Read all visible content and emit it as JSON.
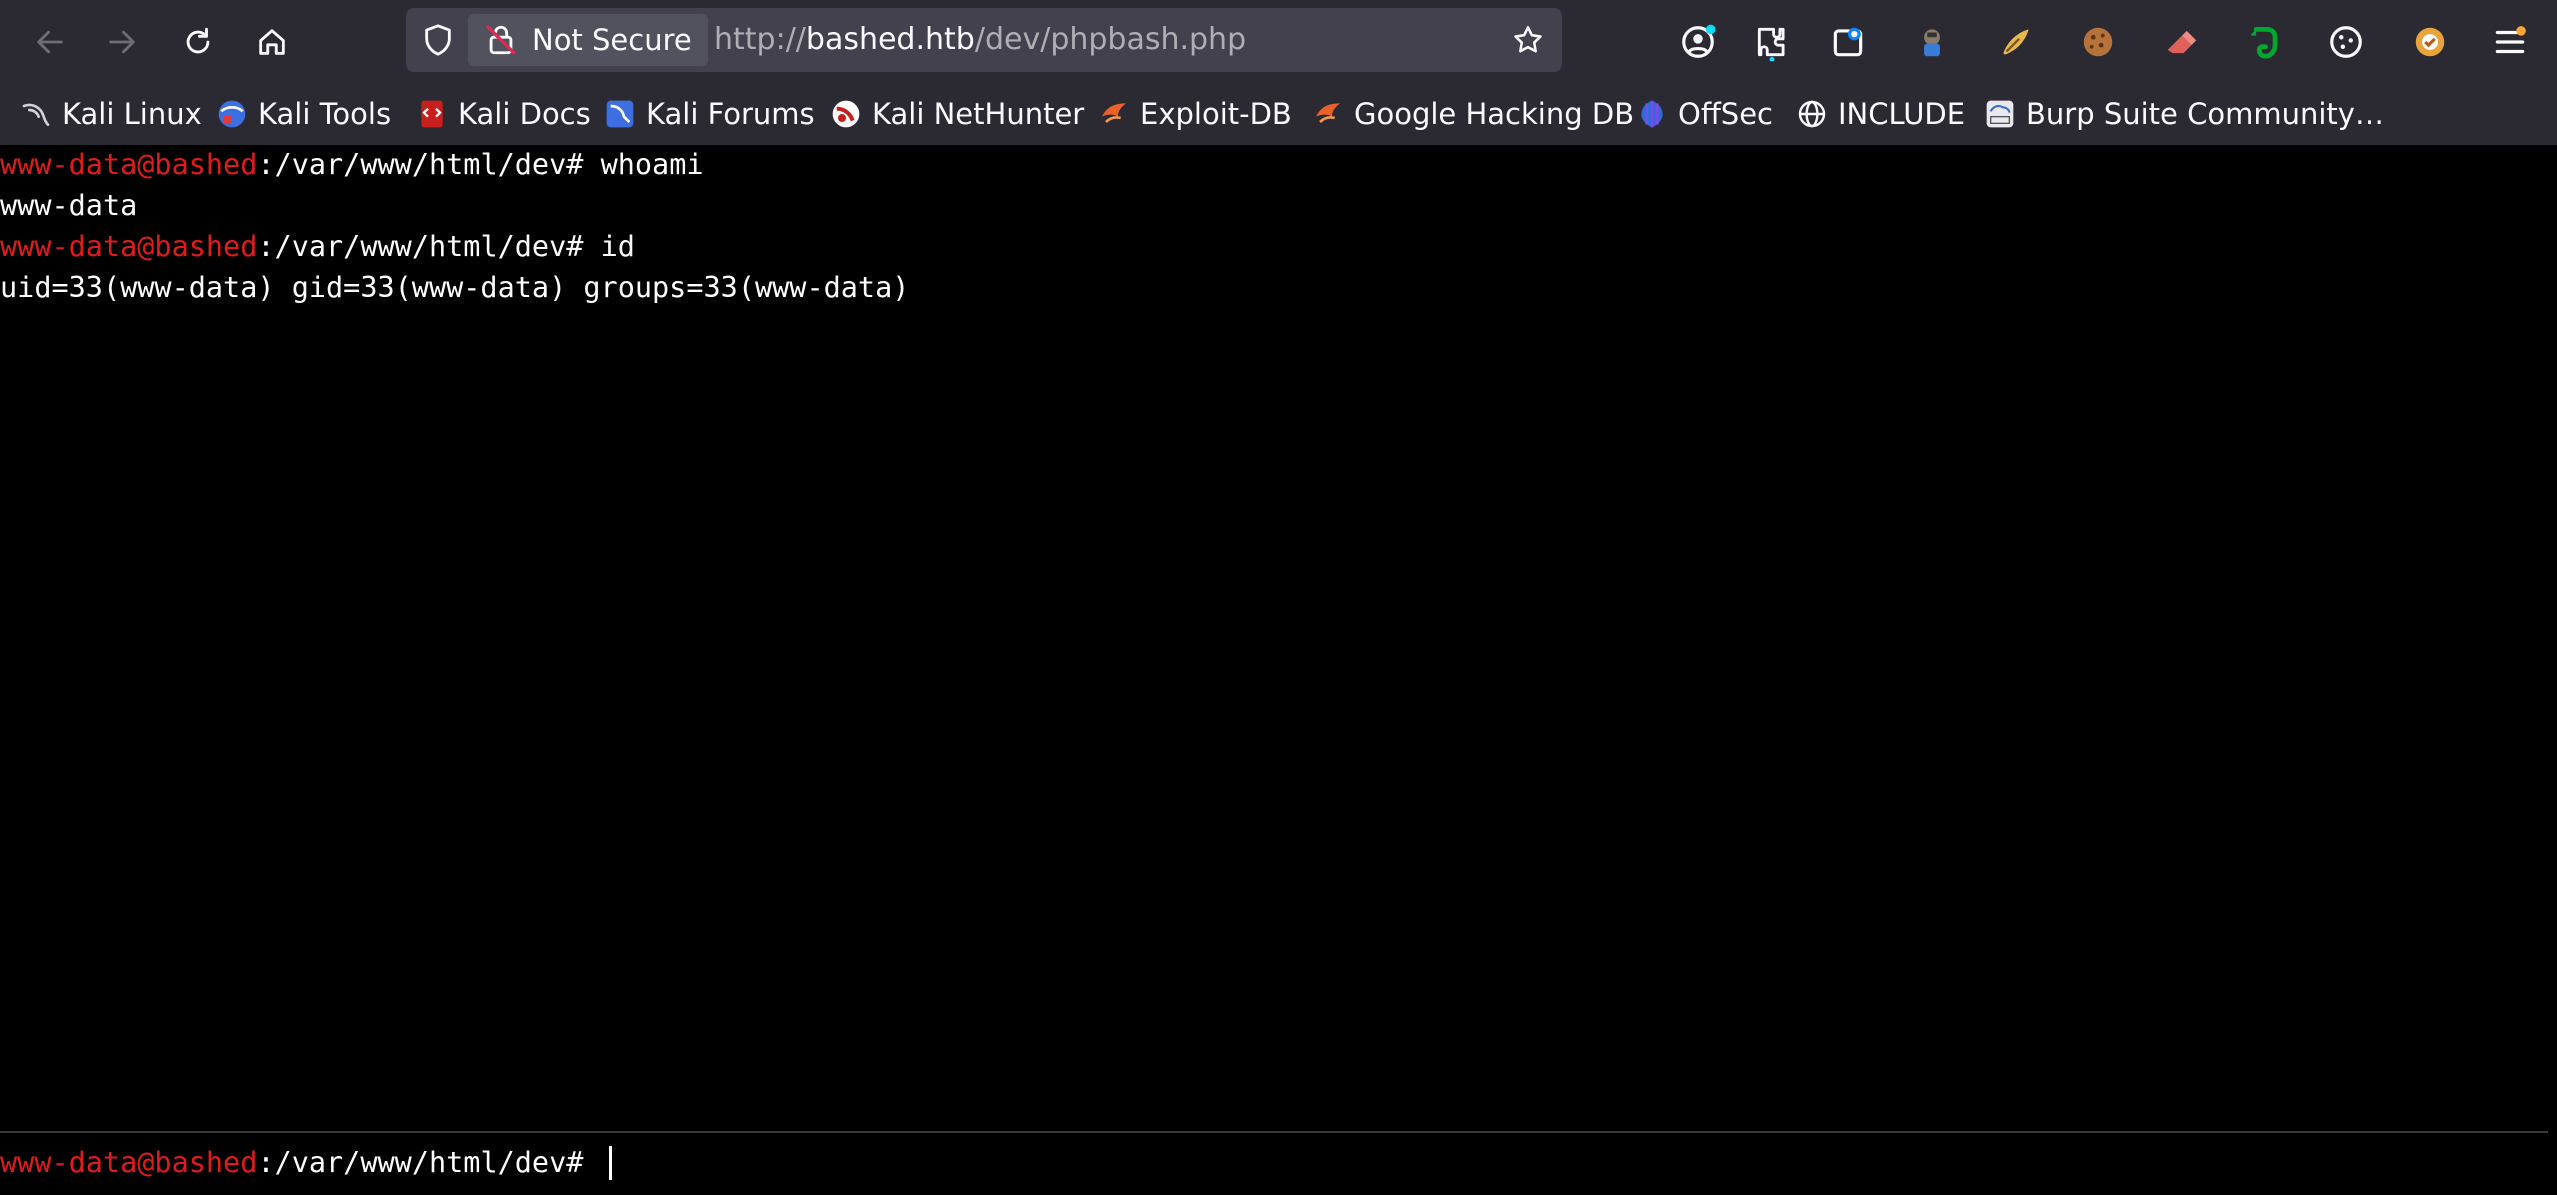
{
  "browser": {
    "url_security_label": "Not Secure",
    "url_scheme": "http://",
    "url_host": "bashed.htb",
    "url_path": "/dev/phpbash.php",
    "nav_icons": [
      "back-arrow-icon",
      "forward-arrow-icon",
      "reload-icon",
      "home-icon"
    ],
    "toolbar_icons": [
      "account-icon",
      "extensions-icon",
      "ext-icon-1",
      "ext-icon-2",
      "ext-icon-3",
      "cookie-icon",
      "eraser-icon",
      "evernote-icon",
      "cookie-editor-icon",
      "ext-icon-4",
      "menu-icon"
    ]
  },
  "bookmarks": [
    {
      "label": "Kali Linux",
      "icon": "kali-dragon-icon"
    },
    {
      "label": "Kali Tools",
      "icon": "kali-tools-icon"
    },
    {
      "label": "Kali Docs",
      "icon": "kali-docs-icon"
    },
    {
      "label": "Kali Forums",
      "icon": "kali-forums-icon"
    },
    {
      "label": "Kali NetHunter",
      "icon": "nethunter-icon"
    },
    {
      "label": "Exploit-DB",
      "icon": "exploit-db-icon"
    },
    {
      "label": "Google Hacking DB",
      "icon": "ghdb-icon"
    },
    {
      "label": "OffSec",
      "icon": "offsec-icon"
    },
    {
      "label": "INCLUDE",
      "icon": "globe-icon"
    },
    {
      "label": "Burp Suite Community…",
      "icon": "burp-icon"
    }
  ],
  "terminal": {
    "prompt_user": "www-data@bashed",
    "prompt_path": ":/var/www/html/dev# ",
    "lines": [
      {
        "kind": "command",
        "text": "whoami"
      },
      {
        "kind": "output",
        "text": "www-data"
      },
      {
        "kind": "command",
        "text": "id"
      },
      {
        "kind": "output",
        "text": "uid=33(www-data) gid=33(www-data) groups=33(www-data)"
      }
    ],
    "input_value": ""
  },
  "colors": {
    "chrome_bg": "#2b2a33",
    "urlbar_bg": "#42414d",
    "terminal_bg": "#000000",
    "prompt_user": "#e01b1b",
    "terminal_text": "#ffffff"
  }
}
